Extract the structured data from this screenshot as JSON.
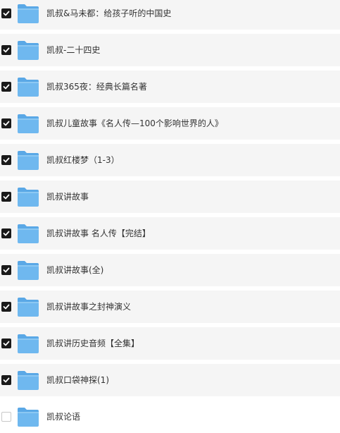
{
  "colors": {
    "row_background": "#f5f5f5",
    "checkbox_checked": "#1a1a1a",
    "folder_blue": "#6fb8ef"
  },
  "folders": [
    {
      "name": "凯叔&马未都：给孩子听的中国史",
      "checked": true
    },
    {
      "name": "凯叔-二十四史",
      "checked": true
    },
    {
      "name": "凯叔365夜：经典长篇名著",
      "checked": true
    },
    {
      "name": "凯叔儿童故事《名人传—100个影响世界的人》",
      "checked": true
    },
    {
      "name": "凯叔红楼梦（1-3）",
      "checked": true
    },
    {
      "name": "凯叔讲故事",
      "checked": true
    },
    {
      "name": "凯叔讲故事 名人传【完结】",
      "checked": true
    },
    {
      "name": "凯叔讲故事(全)",
      "checked": true
    },
    {
      "name": "凯叔讲故事之封神演义",
      "checked": true
    },
    {
      "name": "凯叔讲历史音频【全集】",
      "checked": true
    },
    {
      "name": "凯叔口袋神探(1)",
      "checked": true
    },
    {
      "name": "凯叔论语",
      "checked": false
    }
  ]
}
